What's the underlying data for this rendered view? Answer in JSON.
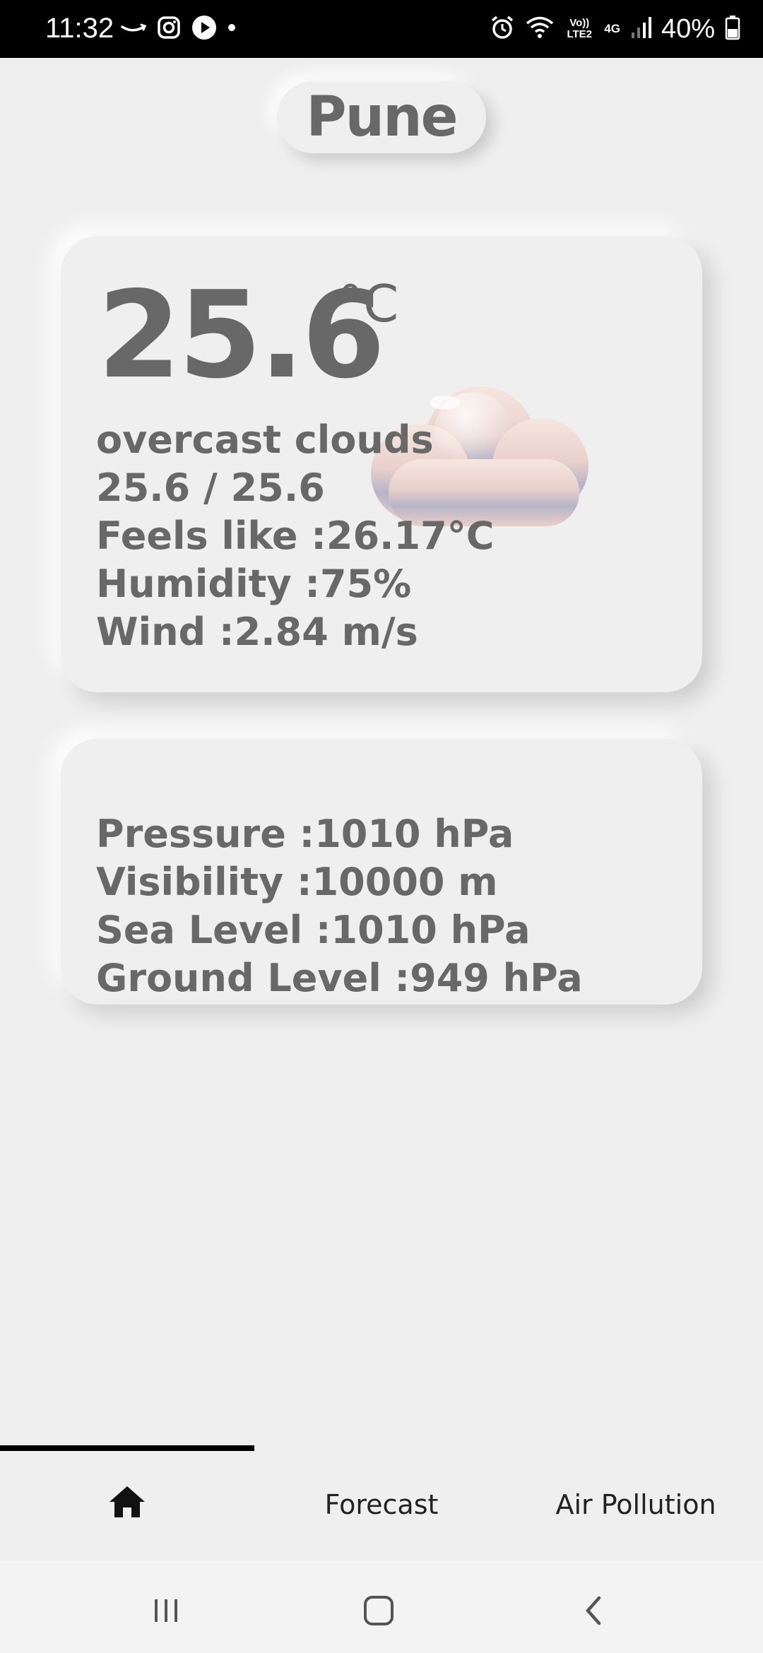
{
  "status_bar": {
    "time": "11:32",
    "left_icons": [
      "amazon-icon",
      "instagram-icon",
      "play-icon",
      "dot-icon"
    ],
    "right_icons": [
      "alarm-icon",
      "wifi-icon",
      "volte-icon",
      "4g-icon",
      "signal-icon",
      "battery-icon"
    ],
    "volte_label": "Vo)) LTE2",
    "network_label": "4G",
    "battery": "40%"
  },
  "city": "Pune",
  "current": {
    "temperature": "25.6",
    "unit": "°C",
    "condition": "overcast clouds",
    "min_max": "25.6 / 25.6",
    "feels_like": "Feels like :26.17°C",
    "humidity": "Humidity :75%",
    "wind": "Wind :2.84 m/s",
    "weather_icon": "cloud-icon"
  },
  "details": {
    "pressure": "Pressure :1010 hPa",
    "visibility": "Visibility :10000 m",
    "sea_level": "Sea Level :1010 hPa",
    "ground_level": "Ground Level :949 hPa"
  },
  "tabs": [
    {
      "label": "",
      "icon": "home-icon",
      "selected": true
    },
    {
      "label": "Forecast",
      "selected": false
    },
    {
      "label": "Air Pollution",
      "selected": false
    }
  ],
  "nav": [
    "recents-icon",
    "home-nav-icon",
    "back-icon"
  ],
  "colors": {
    "background": "#efefef",
    "text": "#686868",
    "status_bar": "#000000",
    "tab_indicator": "#000000"
  }
}
